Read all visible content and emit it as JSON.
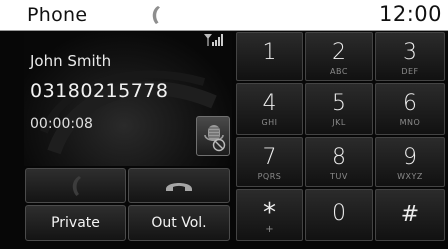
{
  "header": {
    "title": "Phone",
    "time": "12:00",
    "status_icon": "handset-icon",
    "signal_icon": "signal-bars-icon"
  },
  "call": {
    "name": "John Smith",
    "number": "03180215778",
    "duration": "00:00:08",
    "privacy_icon": "mic-mute-icon"
  },
  "controls": {
    "accept_icon": "phone-handset-icon",
    "end_icon": "end-call-icon",
    "private_label": "Private",
    "outvol_label": "Out Vol."
  },
  "keypad": {
    "keys": [
      {
        "digit": "1",
        "letters": ""
      },
      {
        "digit": "2",
        "letters": "ABC"
      },
      {
        "digit": "3",
        "letters": "DEF"
      },
      {
        "digit": "4",
        "letters": "GHI"
      },
      {
        "digit": "5",
        "letters": "JKL"
      },
      {
        "digit": "6",
        "letters": "MNO"
      },
      {
        "digit": "7",
        "letters": "PQRS"
      },
      {
        "digit": "8",
        "letters": "TUV"
      },
      {
        "digit": "9",
        "letters": "WXYZ"
      },
      {
        "digit": "*",
        "letters": "+"
      },
      {
        "digit": "0",
        "letters": ""
      },
      {
        "digit": "#",
        "letters": ""
      }
    ]
  },
  "colors": {
    "background": "#070707",
    "statusbar": "#ffffff",
    "button": "#1f1f1f",
    "text": "#f0f0f0",
    "sublabel": "#8a8a8a"
  }
}
